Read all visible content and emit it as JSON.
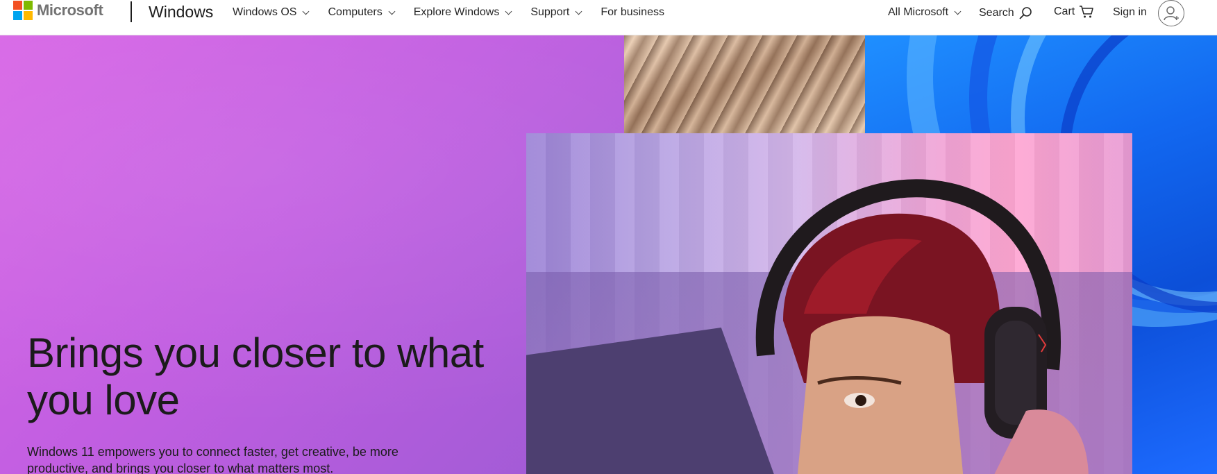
{
  "header": {
    "logo_text": "Microsoft",
    "brand": "Windows",
    "nav": [
      {
        "label": "Windows OS"
      },
      {
        "label": "Computers"
      },
      {
        "label": "Explore Windows"
      },
      {
        "label": "Support"
      },
      {
        "label": "For business"
      }
    ],
    "all_microsoft": "All Microsoft",
    "search": "Search",
    "cart": "Cart",
    "sign_in": "Sign in"
  },
  "hero": {
    "title": "Brings you closer to what you love",
    "subtitle": "Windows 11 empowers you to connect faster, get creative, be more productive, and brings you closer to what matters most."
  },
  "colors": {
    "logo_red": "#f25022",
    "logo_green": "#7fba00",
    "logo_blue": "#00a4ef",
    "logo_yellow": "#ffb900",
    "hero_bg": "#c15ee1",
    "text": "#1b1b1b"
  },
  "icons": [
    "chevron-down-icon",
    "search-icon",
    "cart-icon",
    "user-icon"
  ]
}
